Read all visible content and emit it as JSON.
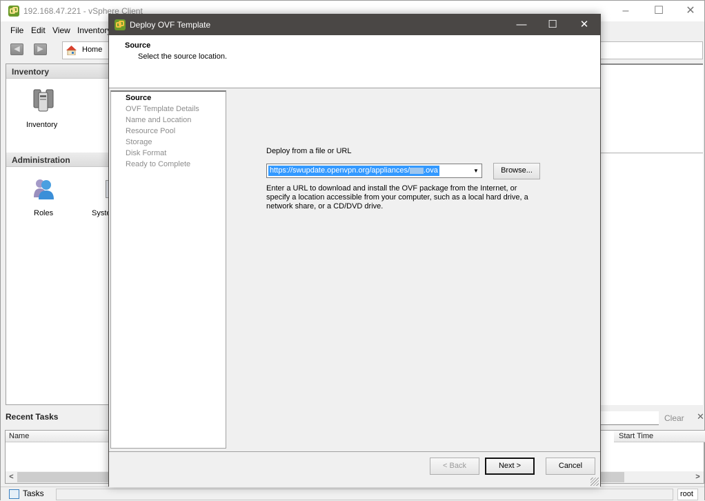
{
  "window": {
    "title": "192.168.47.221 - vSphere Client",
    "controls": {
      "minimize": "–",
      "maximize": "☐",
      "close": "✕"
    }
  },
  "menu": [
    "File",
    "Edit",
    "View",
    "Inventory"
  ],
  "toolbar": {
    "back_icon": "back-arrow-icon",
    "forward_icon": "forward-arrow-icon",
    "home_label": "Home"
  },
  "left_pane": {
    "sections": [
      {
        "title": "Inventory",
        "tiles": [
          {
            "label": "Inventory",
            "icon": "servers-icon"
          }
        ]
      },
      {
        "title": "Administration",
        "tiles": [
          {
            "label": "Roles",
            "icon": "users-icon"
          },
          {
            "label": "Syste",
            "icon": "system-icon"
          }
        ]
      }
    ]
  },
  "recent_tasks": {
    "title": "Recent Tasks",
    "clear_label": "Clear",
    "columns": [
      "Name",
      "Start Time"
    ],
    "scroll_left": "<",
    "scroll_right": ">"
  },
  "status_bar": {
    "tasks_tab": "Tasks",
    "user": "root"
  },
  "dialog": {
    "title": "Deploy OVF Template",
    "controls": {
      "minimize": "—",
      "maximize": "☐",
      "close": "✕"
    },
    "header": {
      "title": "Source",
      "subtitle": "Select the source location."
    },
    "steps": [
      {
        "label": "Source",
        "active": true
      },
      {
        "label": "OVF Template Details",
        "active": false
      },
      {
        "label": "Name and Location",
        "active": false
      },
      {
        "label": "Resource Pool",
        "active": false
      },
      {
        "label": "Storage",
        "active": false
      },
      {
        "label": "Disk Format",
        "active": false
      },
      {
        "label": "Ready to Complete",
        "active": false
      }
    ],
    "source": {
      "label": "Deploy from a file or URL",
      "url_prefix": "https://swupdate.openvpn.org/appliances/",
      "url_suffix": ".ova",
      "browse_label": "Browse...",
      "help_text": "Enter a URL to download and install the OVF package from the Internet, or specify a location accessible from your computer, such as a local hard drive, a network share, or a CD/DVD drive."
    },
    "buttons": {
      "back": "< Back",
      "next": "Next >",
      "cancel": "Cancel"
    }
  },
  "colors": {
    "dialog_titlebar": "#4a4745",
    "selection": "#3399ff",
    "disabled_text": "#8c8c8c"
  }
}
